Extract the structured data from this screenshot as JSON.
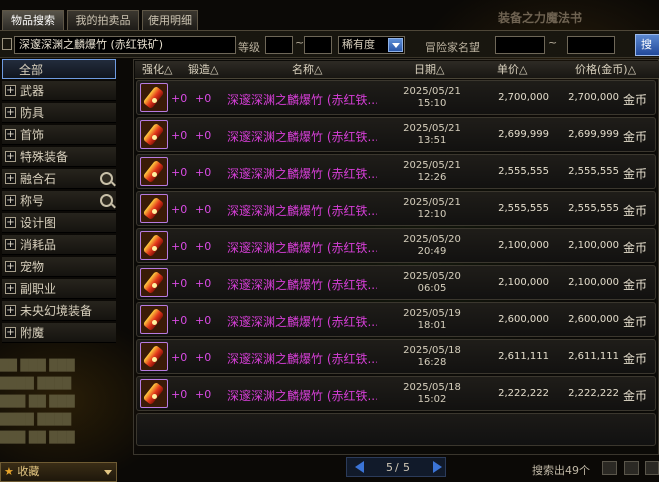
{
  "tabs": [
    "物品搜索",
    "我的拍卖品",
    "使用明细"
  ],
  "title": "装备之力魔法书",
  "search": {
    "query": "深邃深渊之麟爆竹 (赤红铁矿)",
    "level_label": "等级",
    "level_sep": "~",
    "rarity_select": "稀有度",
    "adventurer_label": "冒险家名望",
    "fame_sep": "~",
    "search_button": "搜"
  },
  "sidebar": {
    "items": [
      {
        "label": "全部",
        "zoom": false
      },
      {
        "label": "武器",
        "zoom": false
      },
      {
        "label": "防具",
        "zoom": false
      },
      {
        "label": "首饰",
        "zoom": false
      },
      {
        "label": "特殊装备",
        "zoom": false
      },
      {
        "label": "融合石",
        "zoom": true
      },
      {
        "label": "称号",
        "zoom": true
      },
      {
        "label": "设计图",
        "zoom": false
      },
      {
        "label": "消耗品",
        "zoom": false
      },
      {
        "label": "宠物",
        "zoom": false
      },
      {
        "label": "副职业",
        "zoom": false
      },
      {
        "label": "未央幻境装备",
        "zoom": false
      },
      {
        "label": "附魔",
        "zoom": false
      }
    ],
    "favorites_label": "收藏"
  },
  "table": {
    "headers": [
      "强化△",
      "锻造△",
      "名称△",
      "日期△",
      "单价△",
      "价格(金币)△"
    ],
    "rows": [
      {
        "enhance": "+0",
        "forge": "+0",
        "name": "深邃深渊之麟爆竹 (赤红铁...",
        "date": "2025/05/21",
        "time": "15:10",
        "unit_price": "2,700,000",
        "total": "2,700,000",
        "currency": "金币"
      },
      {
        "enhance": "+0",
        "forge": "+0",
        "name": "深邃深渊之麟爆竹 (赤红铁...",
        "date": "2025/05/21",
        "time": "13:51",
        "unit_price": "2,699,999",
        "total": "2,699,999",
        "currency": "金币"
      },
      {
        "enhance": "+0",
        "forge": "+0",
        "name": "深邃深渊之麟爆竹 (赤红铁...",
        "date": "2025/05/21",
        "time": "12:26",
        "unit_price": "2,555,555",
        "total": "2,555,555",
        "currency": "金币"
      },
      {
        "enhance": "+0",
        "forge": "+0",
        "name": "深邃深渊之麟爆竹 (赤红铁...",
        "date": "2025/05/21",
        "time": "12:10",
        "unit_price": "2,555,555",
        "total": "2,555,555",
        "currency": "金币"
      },
      {
        "enhance": "+0",
        "forge": "+0",
        "name": "深邃深渊之麟爆竹 (赤红铁...",
        "date": "2025/05/20",
        "time": "20:49",
        "unit_price": "2,100,000",
        "total": "2,100,000",
        "currency": "金币"
      },
      {
        "enhance": "+0",
        "forge": "+0",
        "name": "深邃深渊之麟爆竹 (赤红铁...",
        "date": "2025/05/20",
        "time": "06:05",
        "unit_price": "2,100,000",
        "total": "2,100,000",
        "currency": "金币"
      },
      {
        "enhance": "+0",
        "forge": "+0",
        "name": "深邃深渊之麟爆竹 (赤红铁...",
        "date": "2025/05/19",
        "time": "18:01",
        "unit_price": "2,600,000",
        "total": "2,600,000",
        "currency": "金币"
      },
      {
        "enhance": "+0",
        "forge": "+0",
        "name": "深邃深渊之麟爆竹 (赤红铁...",
        "date": "2025/05/18",
        "time": "16:28",
        "unit_price": "2,611,111",
        "total": "2,611,111",
        "currency": "金币"
      },
      {
        "enhance": "+0",
        "forge": "+0",
        "name": "深邃深渊之麟爆竹 (赤红铁...",
        "date": "2025/05/18",
        "time": "15:02",
        "unit_price": "2,222,222",
        "total": "2,222,222",
        "currency": "金币"
      }
    ]
  },
  "pagination": {
    "current": "5",
    "sep": "/",
    "total": "5"
  },
  "result_count": "搜索出49个",
  "colors": {
    "item_name": "#d53ed6",
    "accent": "#3b74d6"
  }
}
